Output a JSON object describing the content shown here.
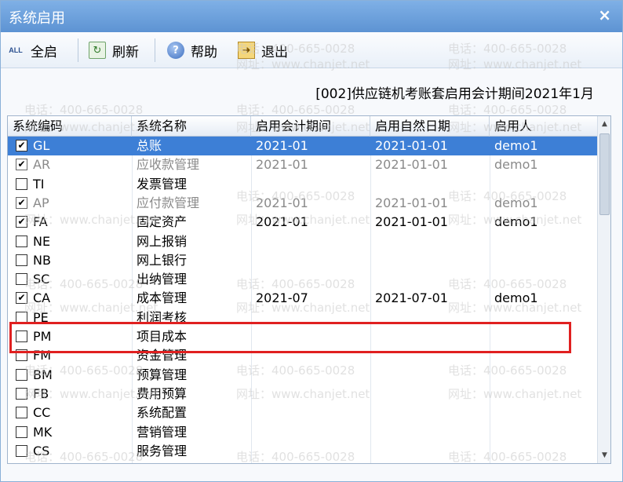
{
  "window": {
    "title": "系统启用",
    "close_glyph": "×"
  },
  "toolbar": {
    "select_all_label": "全启",
    "select_all_icon": "ALL",
    "refresh_label": "刷新",
    "help_label": "帮助",
    "exit_label": "退出"
  },
  "period_info": "[002]供应链机考账套启用会计期间2021年1月",
  "table": {
    "columns": [
      "系统编码",
      "系统名称",
      "启用会计期间",
      "启用自然日期",
      "启用人"
    ],
    "rows": [
      {
        "checked": true,
        "code": "GL",
        "name": "总账",
        "period": "2021-01",
        "date": "2021-01-01",
        "user": "demo1"
      },
      {
        "checked": true,
        "code": "AR",
        "name": "应收款管理",
        "period": "2021-01",
        "date": "2021-01-01",
        "user": "demo1"
      },
      {
        "checked": false,
        "code": "TI",
        "name": "发票管理",
        "period": "",
        "date": "",
        "user": ""
      },
      {
        "checked": true,
        "code": "AP",
        "name": "应付款管理",
        "period": "2021-01",
        "date": "2021-01-01",
        "user": "demo1"
      },
      {
        "checked": true,
        "code": "FA",
        "name": "固定资产",
        "period": "2021-01",
        "date": "2021-01-01",
        "user": "demo1"
      },
      {
        "checked": false,
        "code": "NE",
        "name": "网上报销",
        "period": "",
        "date": "",
        "user": ""
      },
      {
        "checked": false,
        "code": "NB",
        "name": "网上银行",
        "period": "",
        "date": "",
        "user": ""
      },
      {
        "checked": false,
        "code": "SC",
        "name": "出纳管理",
        "period": "",
        "date": "",
        "user": ""
      },
      {
        "checked": true,
        "code": "CA",
        "name": "成本管理",
        "period": "2021-07",
        "date": "2021-07-01",
        "user": "demo1"
      },
      {
        "checked": false,
        "code": "PE",
        "name": "利润考核",
        "period": "",
        "date": "",
        "user": ""
      },
      {
        "checked": false,
        "code": "PM",
        "name": "项目成本",
        "period": "",
        "date": "",
        "user": ""
      },
      {
        "checked": false,
        "code": "FM",
        "name": "资金管理",
        "period": "",
        "date": "",
        "user": ""
      },
      {
        "checked": false,
        "code": "BM",
        "name": "预算管理",
        "period": "",
        "date": "",
        "user": ""
      },
      {
        "checked": false,
        "code": "FB",
        "name": "费用预算",
        "period": "",
        "date": "",
        "user": ""
      },
      {
        "checked": false,
        "code": "CC",
        "name": "系统配置",
        "period": "",
        "date": "",
        "user": ""
      },
      {
        "checked": false,
        "code": "MK",
        "name": "营销管理",
        "period": "",
        "date": "",
        "user": ""
      },
      {
        "checked": false,
        "code": "CS",
        "name": "服务管理",
        "period": "",
        "date": "",
        "user": ""
      }
    ],
    "selected_row": 0,
    "grey_rows": [
      1,
      3
    ]
  },
  "watermark": {
    "phone": "电话：400-665-0028",
    "site": "网址：www.chanjet.net"
  },
  "colors": {
    "titlebar": "#5d93d3",
    "selection": "#3d7fd6",
    "highlight": "#e02020"
  }
}
